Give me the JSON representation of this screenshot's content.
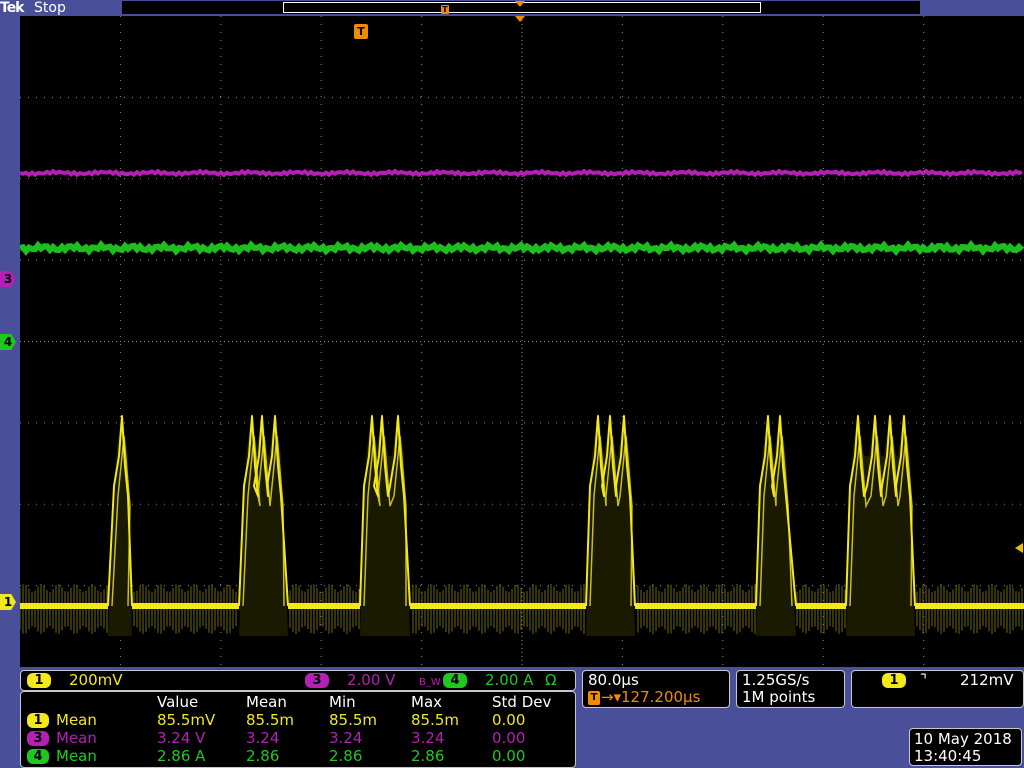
{
  "header": {
    "brand": "Tek",
    "run_state": "Stop"
  },
  "markers": {
    "trigger_glyph": "T",
    "ch1": "1",
    "ch3": "3",
    "ch4": "4"
  },
  "colors": {
    "ch1": "#f2e81a",
    "ch3": "#b41fb4",
    "ch4": "#1fc81f",
    "trigger": "#f08c00",
    "background": "#4a4f99",
    "grid": "#8a8a8a"
  },
  "channels": {
    "ch1": {
      "number": "1",
      "scale": "200mV"
    },
    "ch3": {
      "number": "3",
      "scale": "2.00 V",
      "bw_icon": "B_W",
      "bw_symbol": "bandwidth-limit-icon"
    },
    "ch4": {
      "number": "4",
      "scale": "2.00 A",
      "unit_symbol": "Ω"
    }
  },
  "horizontal": {
    "timebase": "80.0µs",
    "trigger_position": "127.200µs",
    "sample_rate": "1.25GS/s",
    "record_length": "1M points"
  },
  "trigger": {
    "source": "1",
    "slope_icon": "falling-edge-icon",
    "slope_glyph": "⌝",
    "level": "212mV"
  },
  "measurements": {
    "headers": [
      "Value",
      "Mean",
      "Min",
      "Max",
      "Std Dev"
    ],
    "rows": [
      {
        "channel": "1",
        "type": "Mean",
        "value": "85.5mV",
        "mean": "85.5m",
        "min": "85.5m",
        "max": "85.5m",
        "std": "0.00"
      },
      {
        "channel": "3",
        "type": "Mean",
        "value": "3.24 V",
        "mean": "3.24",
        "min": "3.24",
        "max": "3.24",
        "std": "0.00"
      },
      {
        "channel": "4",
        "type": "Mean",
        "value": "2.86 A",
        "mean": "2.86",
        "min": "2.86",
        "max": "2.86",
        "std": "0.00"
      }
    ]
  },
  "datetime": {
    "date": "10 May 2018",
    "time": "13:40:45"
  }
}
